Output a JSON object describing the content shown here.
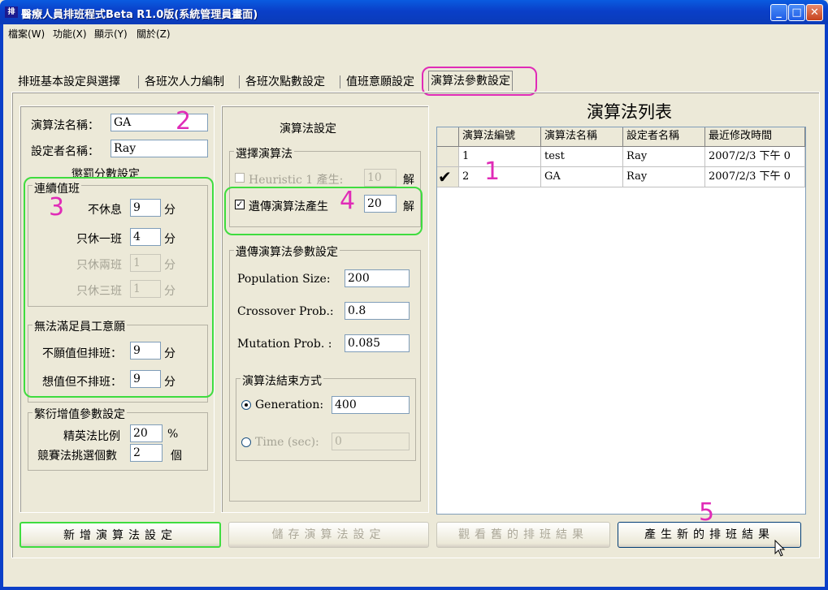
{
  "window": {
    "title": "醫療人員排班程式Beta R1.0版(系統管理員畫面)",
    "icon": "app-icon"
  },
  "menu": [
    "檔案(W)",
    "功能(X)",
    "顯示(Y)",
    "關於(Z)"
  ],
  "tabs": [
    {
      "label": "排班基本設定與選擇"
    },
    {
      "label": "各班次人力編制"
    },
    {
      "label": "各班次點數設定"
    },
    {
      "label": "值班意願設定"
    },
    {
      "label": "演算法參數設定",
      "selected": true
    }
  ],
  "left_panel": {
    "algo_name_label": "演算法名稱：",
    "algo_name_value": "GA",
    "setter_label": "設定者名稱：",
    "setter_value": "Ray",
    "penalty_title": "懲罰分數設定",
    "consecutive_title": "連續值班",
    "rows": [
      {
        "label": "不休息",
        "value": "9",
        "unit": "分",
        "enabled": true
      },
      {
        "label": "只休一班",
        "value": "4",
        "unit": "分",
        "enabled": true
      },
      {
        "label": "只休兩班",
        "value": "1",
        "unit": "分",
        "enabled": false
      },
      {
        "label": "只休三班",
        "value": "1",
        "unit": "分",
        "enabled": false
      }
    ],
    "wish_title": "無法滿足員工意願",
    "wish_rows": [
      {
        "label": "不願值但排班：",
        "value": "9",
        "unit": "分"
      },
      {
        "label": "想值但不排班：",
        "value": "9",
        "unit": "分"
      }
    ],
    "breed_title": "繁衍增值參數設定",
    "breed_rows": [
      {
        "label": "精英法比例",
        "value": "20",
        "unit": "%"
      },
      {
        "label": "競賽法挑選個數",
        "value": "2",
        "unit": "個"
      }
    ]
  },
  "middle_panel": {
    "title": "演算法設定",
    "select_title": "選擇演算法",
    "heuristic_label": "Heuristic 1 產生:",
    "heuristic_value": "10",
    "heuristic_unit": "解",
    "ga_label": "遺傳演算法產生",
    "ga_value": "20",
    "ga_unit": "解",
    "ga_check": "✓",
    "params_title": "遺傳演算法參數設定",
    "params": [
      {
        "label": "Population Size:",
        "value": "200"
      },
      {
        "label": "Crossover Prob.:",
        "value": "0.8"
      },
      {
        "label": "Mutation Prob. :",
        "value": "0.085"
      }
    ],
    "end_title": "演算法結束方式",
    "generation_label": "Generation:",
    "generation_value": "400",
    "time_label": "Time (sec):",
    "time_value": "0"
  },
  "right_panel": {
    "title": "演算法列表",
    "columns": [
      "演算法編號",
      "演算法名稱",
      "設定者名稱",
      "最近修改時間"
    ],
    "rows": [
      {
        "id": "1",
        "name": "test",
        "setter": "Ray",
        "time": "2007/2/3 下午 0",
        "selected": false
      },
      {
        "id": "2",
        "name": "GA",
        "setter": "Ray",
        "time": "2007/2/3 下午 0",
        "selected": true
      }
    ],
    "row_marker": "✔"
  },
  "buttons": {
    "add": "新增演算法設定",
    "save": "儲存演算法設定",
    "view": "觀看舊的排班結果",
    "generate": "產生新的排班結果"
  },
  "annotations": [
    "1",
    "2",
    "3",
    "4",
    "5"
  ],
  "colors": {
    "annotation": "#e02bb7",
    "highlight": "#3fdc3f",
    "titlebar": "#0a5be0"
  }
}
